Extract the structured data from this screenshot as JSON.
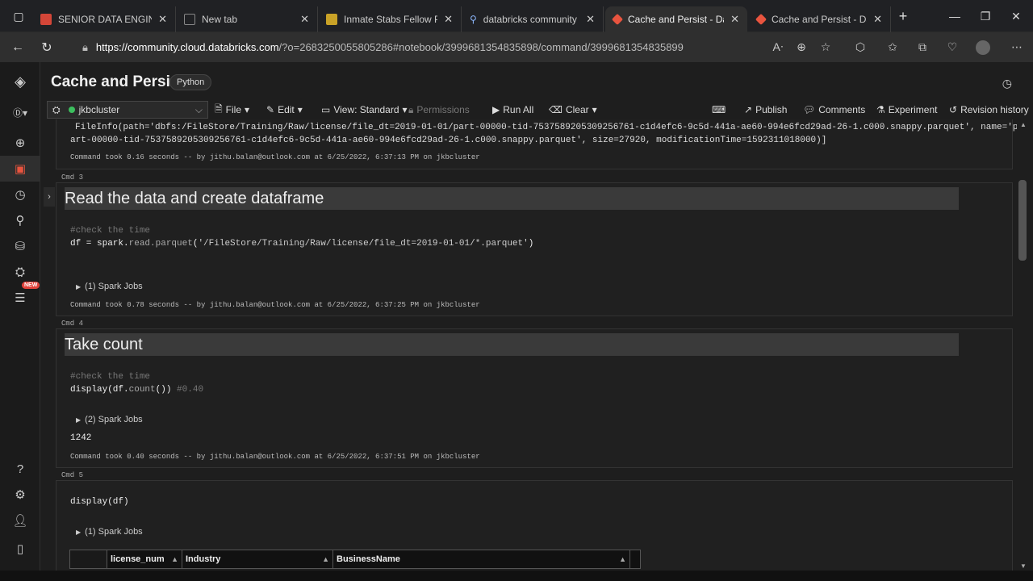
{
  "browser": {
    "tabs": [
      {
        "title": "SENIOR DATA ENGINEER jo",
        "favicon_color": "#d44638"
      },
      {
        "title": "New tab",
        "favicon_color": "#777777"
      },
      {
        "title": "Inmate Stabs Fellow Prisone",
        "favicon_color": "#c9a227"
      },
      {
        "title": "databricks community editi",
        "favicon_color": "#8ab4f8"
      },
      {
        "title": "Cache and Persist - Databri",
        "favicon_color": "#e8543f"
      },
      {
        "title": "Cache and Persist - Databri",
        "favicon_color": "#e8543f"
      }
    ],
    "url_host": "https://community.cloud.databricks.com",
    "url_path": "/?o=2683250055805286#notebook/3999681354835898/command/3999681354835899"
  },
  "notebook": {
    "title": "Cache and Persist",
    "language": "Python",
    "cluster": "jkbcluster",
    "toolbar": {
      "file": "File",
      "edit": "Edit",
      "view": "View: Standard",
      "permissions": "Permissions",
      "run_all": "Run All",
      "clear": "Clear",
      "publish": "Publish",
      "comments": "Comments",
      "experiment": "Experiment",
      "revision_history": "Revision history"
    }
  },
  "cells": {
    "prev_output_line1": "FileInfo(path='dbfs:/FileStore/Training/Raw/license/file_dt=2019-01-01/part-00000-tid-7537589205309256761-c1d4efc6-9c5d-441a-ae60-994e6fcd29ad-26-1.c000.snappy.parquet', name='p",
    "prev_output_line2": "art-00000-tid-7537589205309256761-c1d4efc6-9c5d-441a-ae60-994e6fcd29ad-26-1.c000.snappy.parquet', size=27920, modificationTime=1592311018000)]",
    "prev_took": "Command took 0.16 seconds -- by jithu.balan@outlook.com at 6/25/2022, 6:37:13 PM on jkbcluster",
    "cmd3": {
      "label": "Cmd 3",
      "heading": "Read the data and create dataframe",
      "comment": "#check the time",
      "code_a": "df = spark.",
      "code_fn": "read.parquet",
      "code_b": "(",
      "code_str": "'/FileStore/Training/Raw/license/file_dt=2019-01-01/*.parquet'",
      "code_c": ")",
      "jobs": "(1) Spark Jobs",
      "took": "Command took 0.78 seconds -- by jithu.balan@outlook.com at 6/25/2022, 6:37:25 PM on jkbcluster"
    },
    "cmd4": {
      "label": "Cmd 4",
      "heading": "Take count",
      "comment": "#check the time",
      "code_a": "display(df.",
      "code_fn": "count",
      "code_b": "()) ",
      "code_cmt": "#0.40",
      "jobs": "(2) Spark Jobs",
      "result": "1242",
      "took": "Command took 0.40 seconds -- by jithu.balan@outlook.com at 6/25/2022, 6:37:51 PM on jkbcluster"
    },
    "cmd5": {
      "label": "Cmd 5",
      "code": "display(df)",
      "jobs": "(1) Spark Jobs",
      "table_headers": [
        "license_num",
        "Industry",
        "BusinessName"
      ]
    }
  }
}
